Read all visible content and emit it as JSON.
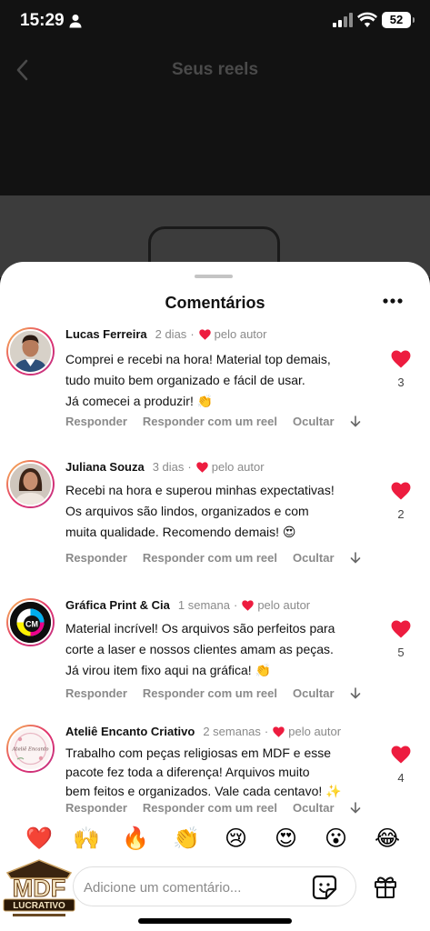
{
  "status_bar": {
    "time": "15:29",
    "battery": "52"
  },
  "header": {
    "title": "Seus reels"
  },
  "sheet": {
    "title": "Comentários"
  },
  "comments": [
    {
      "user": "Lucas Ferreira",
      "time": "2 dias",
      "author_label": "pelo autor",
      "lines": [
        "Comprei e recebi na hora! Material top demais,",
        "tudo muito bem organizado e fácil de usar.",
        "Já comecei a produzir! 👏"
      ],
      "likes": "3",
      "actions": [
        "Responder",
        "Responder com um reel",
        "Ocultar"
      ]
    },
    {
      "user": "Juliana Souza",
      "time": "3 dias",
      "author_label": "pelo autor",
      "lines": [
        "Recebi na hora e superou minhas expectativas!",
        "Os arquivos são lindos, organizados e com",
        "muita qualidade. Recomendo demais! 😍"
      ],
      "likes": "2",
      "actions": [
        "Responder",
        "Responder com um reel",
        "Ocultar"
      ]
    },
    {
      "user": "Gráfica Print & Cia",
      "time": "1 semana",
      "author_label": "pelo autor",
      "lines": [
        "Material incrível! Os arquivos são perfeitos para",
        "corte a laser e nossos clientes amam as peças.",
        "Já virou item fixo aqui na gráfica! 👏"
      ],
      "likes": "5",
      "actions": [
        "Responder",
        "Responder com um reel",
        "Ocultar"
      ],
      "avatar_text": "CM"
    },
    {
      "user": "Ateliê Encanto Criativo",
      "time": "2 semanas",
      "author_label": "pelo autor",
      "lines": [
        "Trabalho com peças religiosas em MDF e esse",
        "pacote fez toda a diferença! Arquivos muito",
        "bem feitos e organizados. Vale cada centavo! ✨"
      ],
      "likes": "4",
      "actions": [
        "Responder",
        "Responder com um reel",
        "Ocultar"
      ],
      "avatar_text": "Ateliê Encanto"
    }
  ],
  "emoji_bar": [
    "❤️",
    "🙌",
    "🔥",
    "👏",
    "😢",
    "😍",
    "😮",
    "😂"
  ],
  "input": {
    "placeholder": "Adicione um comentário..."
  },
  "logo": {
    "line1": "MDF",
    "line2": "LUCRATIVO"
  },
  "colors": {
    "heart": "#ed1c3f",
    "sheet_bg": "#ffffff",
    "muted_text": "#8a8a8a"
  }
}
